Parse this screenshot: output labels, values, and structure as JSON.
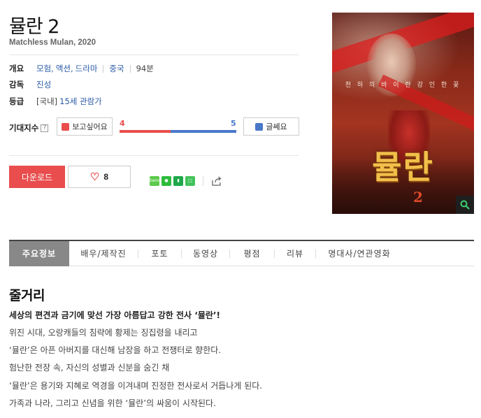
{
  "movie": {
    "title": "뮬란 2",
    "original_title_year": "Matchless Mulan, 2020"
  },
  "info": {
    "overview_label": "개요",
    "genres": [
      "모험",
      "액션",
      "드라마"
    ],
    "country": "중국",
    "runtime": "94분",
    "director_label": "감독",
    "director": "진성",
    "rating_label": "등급",
    "rating_prefix": "[국내]",
    "rating": "15세 관람가"
  },
  "expectation": {
    "label": "기대지수",
    "help_icon": "?",
    "want_label": "보고싶어요",
    "meh_label": "글쎄요",
    "want_count": "4",
    "meh_count": "5",
    "want_ratio": 0.44
  },
  "actions": {
    "download_label": "다운로드",
    "like_count": "8"
  },
  "share": {
    "icons": [
      "band-icon",
      "kakaotalk-icon",
      "bookmark-icon",
      "note-icon",
      "share-icon"
    ]
  },
  "poster": {
    "tagline": "천 하 의   바 이 란   강 인 한   꽃",
    "logo_text": "뮬란",
    "logo_number": "2"
  },
  "tabs": [
    {
      "label": "주요정보",
      "active": true
    },
    {
      "label": "배우/제작진",
      "active": false
    },
    {
      "label": "포토",
      "active": false
    },
    {
      "label": "동영상",
      "active": false
    },
    {
      "label": "평점",
      "active": false
    },
    {
      "label": "리뷰",
      "active": false
    },
    {
      "label": "명대사/연관영화",
      "active": false
    }
  ],
  "synopsis": {
    "title": "줄거리",
    "headline": "세상의 편견과 금기에 맞선 가장 아름답고 강한 전사 ‘뮬란’!",
    "lines": [
      "위진 시대, 오랑캐들의 침략에 황제는 징집령을 내리고",
      " ‘뮬란’은 아픈 아버지를 대신해 남장을 하고 전쟁터로 향한다.",
      " 험난한 전장 속, 자신의 성별과 신분을 숨긴 채",
      " ‘뮬란’은 용기와 지혜로 역경을 이겨내며 진정한 전사로서 거듭나게 된다.",
      " 가족과 나라, 그리고 신념을 위한 ‘뮬란’의 싸움이 시작된다."
    ]
  },
  "colors": {
    "accent_red": "#e94d4d",
    "accent_blue": "#4a78c9",
    "link": "#2a5aa8"
  }
}
